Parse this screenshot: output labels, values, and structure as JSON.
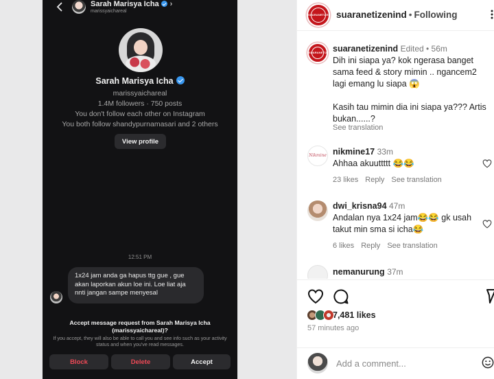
{
  "dm": {
    "header": {
      "name": "Sarah Marisya Icha",
      "handle": "marissyaichareal",
      "chevron": "›"
    },
    "profile": {
      "name": "Sarah Marisya Icha",
      "handle": "marissyaichareal",
      "stats": "1.4M followers · 750 posts",
      "follow_status": "You don't follow each other on Instagram",
      "mutual": "You both follow shandypurnamasari and 2 others",
      "view_profile": "View profile"
    },
    "timestamp": "12:51 PM",
    "message": "1x24 jam anda ga hapus ttg gue , gue akan laporkan akun loe ini. Loe liat aja nnti jangan sampe menyesal",
    "request": {
      "title": "Accept message request from Sarah Marisya Icha (marissyaichareal)?",
      "note": "If you accept, they will also be able to call you and see info such as your activity status and when you've read messages.",
      "block": "Block",
      "delete": "Delete",
      "accept": "Accept"
    }
  },
  "post": {
    "header": {
      "username": "suaranetizenind",
      "dot": "•",
      "follow_state": "Following",
      "logo_text": "SUARANETIZEN"
    },
    "caption": {
      "username": "suaranetizenind",
      "meta": "Edited • 56m",
      "line1": "Dih ini siapa ya? kok ngerasa banget sama feed & story mimin .. ngancem2 lagi emang lu siapa 😱",
      "line2": "Kasih tau mimin dia ini siapa ya??? Artis bukan......?",
      "see_translation": "See translation"
    },
    "comments": [
      {
        "username": "nikmine17",
        "time": "33m",
        "text": "Ahhaa akuuttttt 😂😂",
        "likes": "23 likes",
        "reply": "Reply",
        "translate": "See translation",
        "avatar_text": "Nikmine"
      },
      {
        "username": "dwi_krisna94",
        "time": "47m",
        "text": "Andalan nya 1x24 jam😂😂 gk usah takut min sma si icha😂",
        "likes": "6 likes",
        "reply": "Reply",
        "translate": "See translation"
      },
      {
        "username": "nemanurung",
        "time": "37m"
      }
    ],
    "likes_count": "7,481 likes",
    "time_ago": "57 minutes ago",
    "add_comment_placeholder": "Add a comment..."
  },
  "colors": {
    "dm_bg": "#121214",
    "bubble": "#2a2a2d",
    "danger": "#ed4956",
    "verified": "#3897f0",
    "brand": "#c4161c"
  },
  "icons": [
    "back-icon",
    "verified-icon",
    "chevron-right-icon",
    "more-icon",
    "heart-icon",
    "comment-icon",
    "share-icon",
    "emoji-icon"
  ]
}
